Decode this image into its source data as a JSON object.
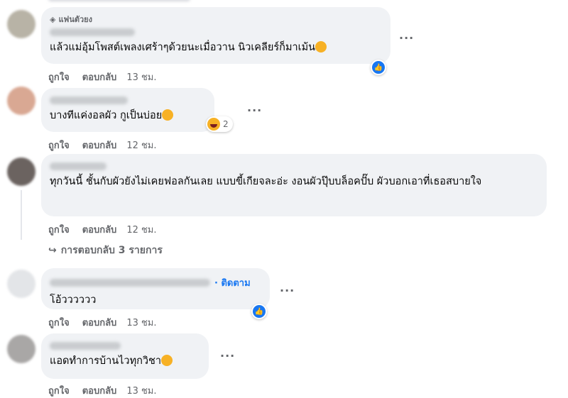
{
  "comments": [
    {
      "badge": "แฟนตัวยง",
      "text": "แล้วแม่อุ้มโพสต์เพลงเศร้าๆด้วยนะเมื่อวาน นิวเคลียร์ก็มาเม้น",
      "like": "ถูกใจ",
      "reply": "ตอบกลับ",
      "time": "13 ชม.",
      "reaction": "like"
    },
    {
      "text": "บางทีแค่งอลผัว กูเป็นบ่อย",
      "like": "ถูกใจ",
      "reply": "ตอบกลับ",
      "time": "12 ชม.",
      "reaction": "haha",
      "reaction_count": "2"
    },
    {
      "text": "ทุกวันนี้ ชั้นกับผัวยังไม่เคยฟอลกันเลย แบบขี้เกียจละอ่ะ งอนผัวปุ๊บบล็อคปั๊บ ผัวบอกเอาที่เธอสบายใจ",
      "like": "ถูกใจ",
      "reply": "ตอบกลับ",
      "time": "12 ชม.",
      "replies_label": "การตอบกลับ 3 รายการ"
    },
    {
      "follow": "· ติดตาม",
      "text": "โอ้วววววว",
      "like": "ถูกใจ",
      "reply": "ตอบกลับ",
      "time": "13 ชม.",
      "reaction": "like"
    },
    {
      "text": "แอดทำการบ้านไวทุกวิชา",
      "like": "ถูกใจ",
      "reply": "ตอบกลับ",
      "time": "13 ชม."
    }
  ],
  "more_label": "···",
  "colors": {
    "bubble": "#f0f2f5",
    "meta": "#65676b",
    "accent": "#1877f2"
  }
}
